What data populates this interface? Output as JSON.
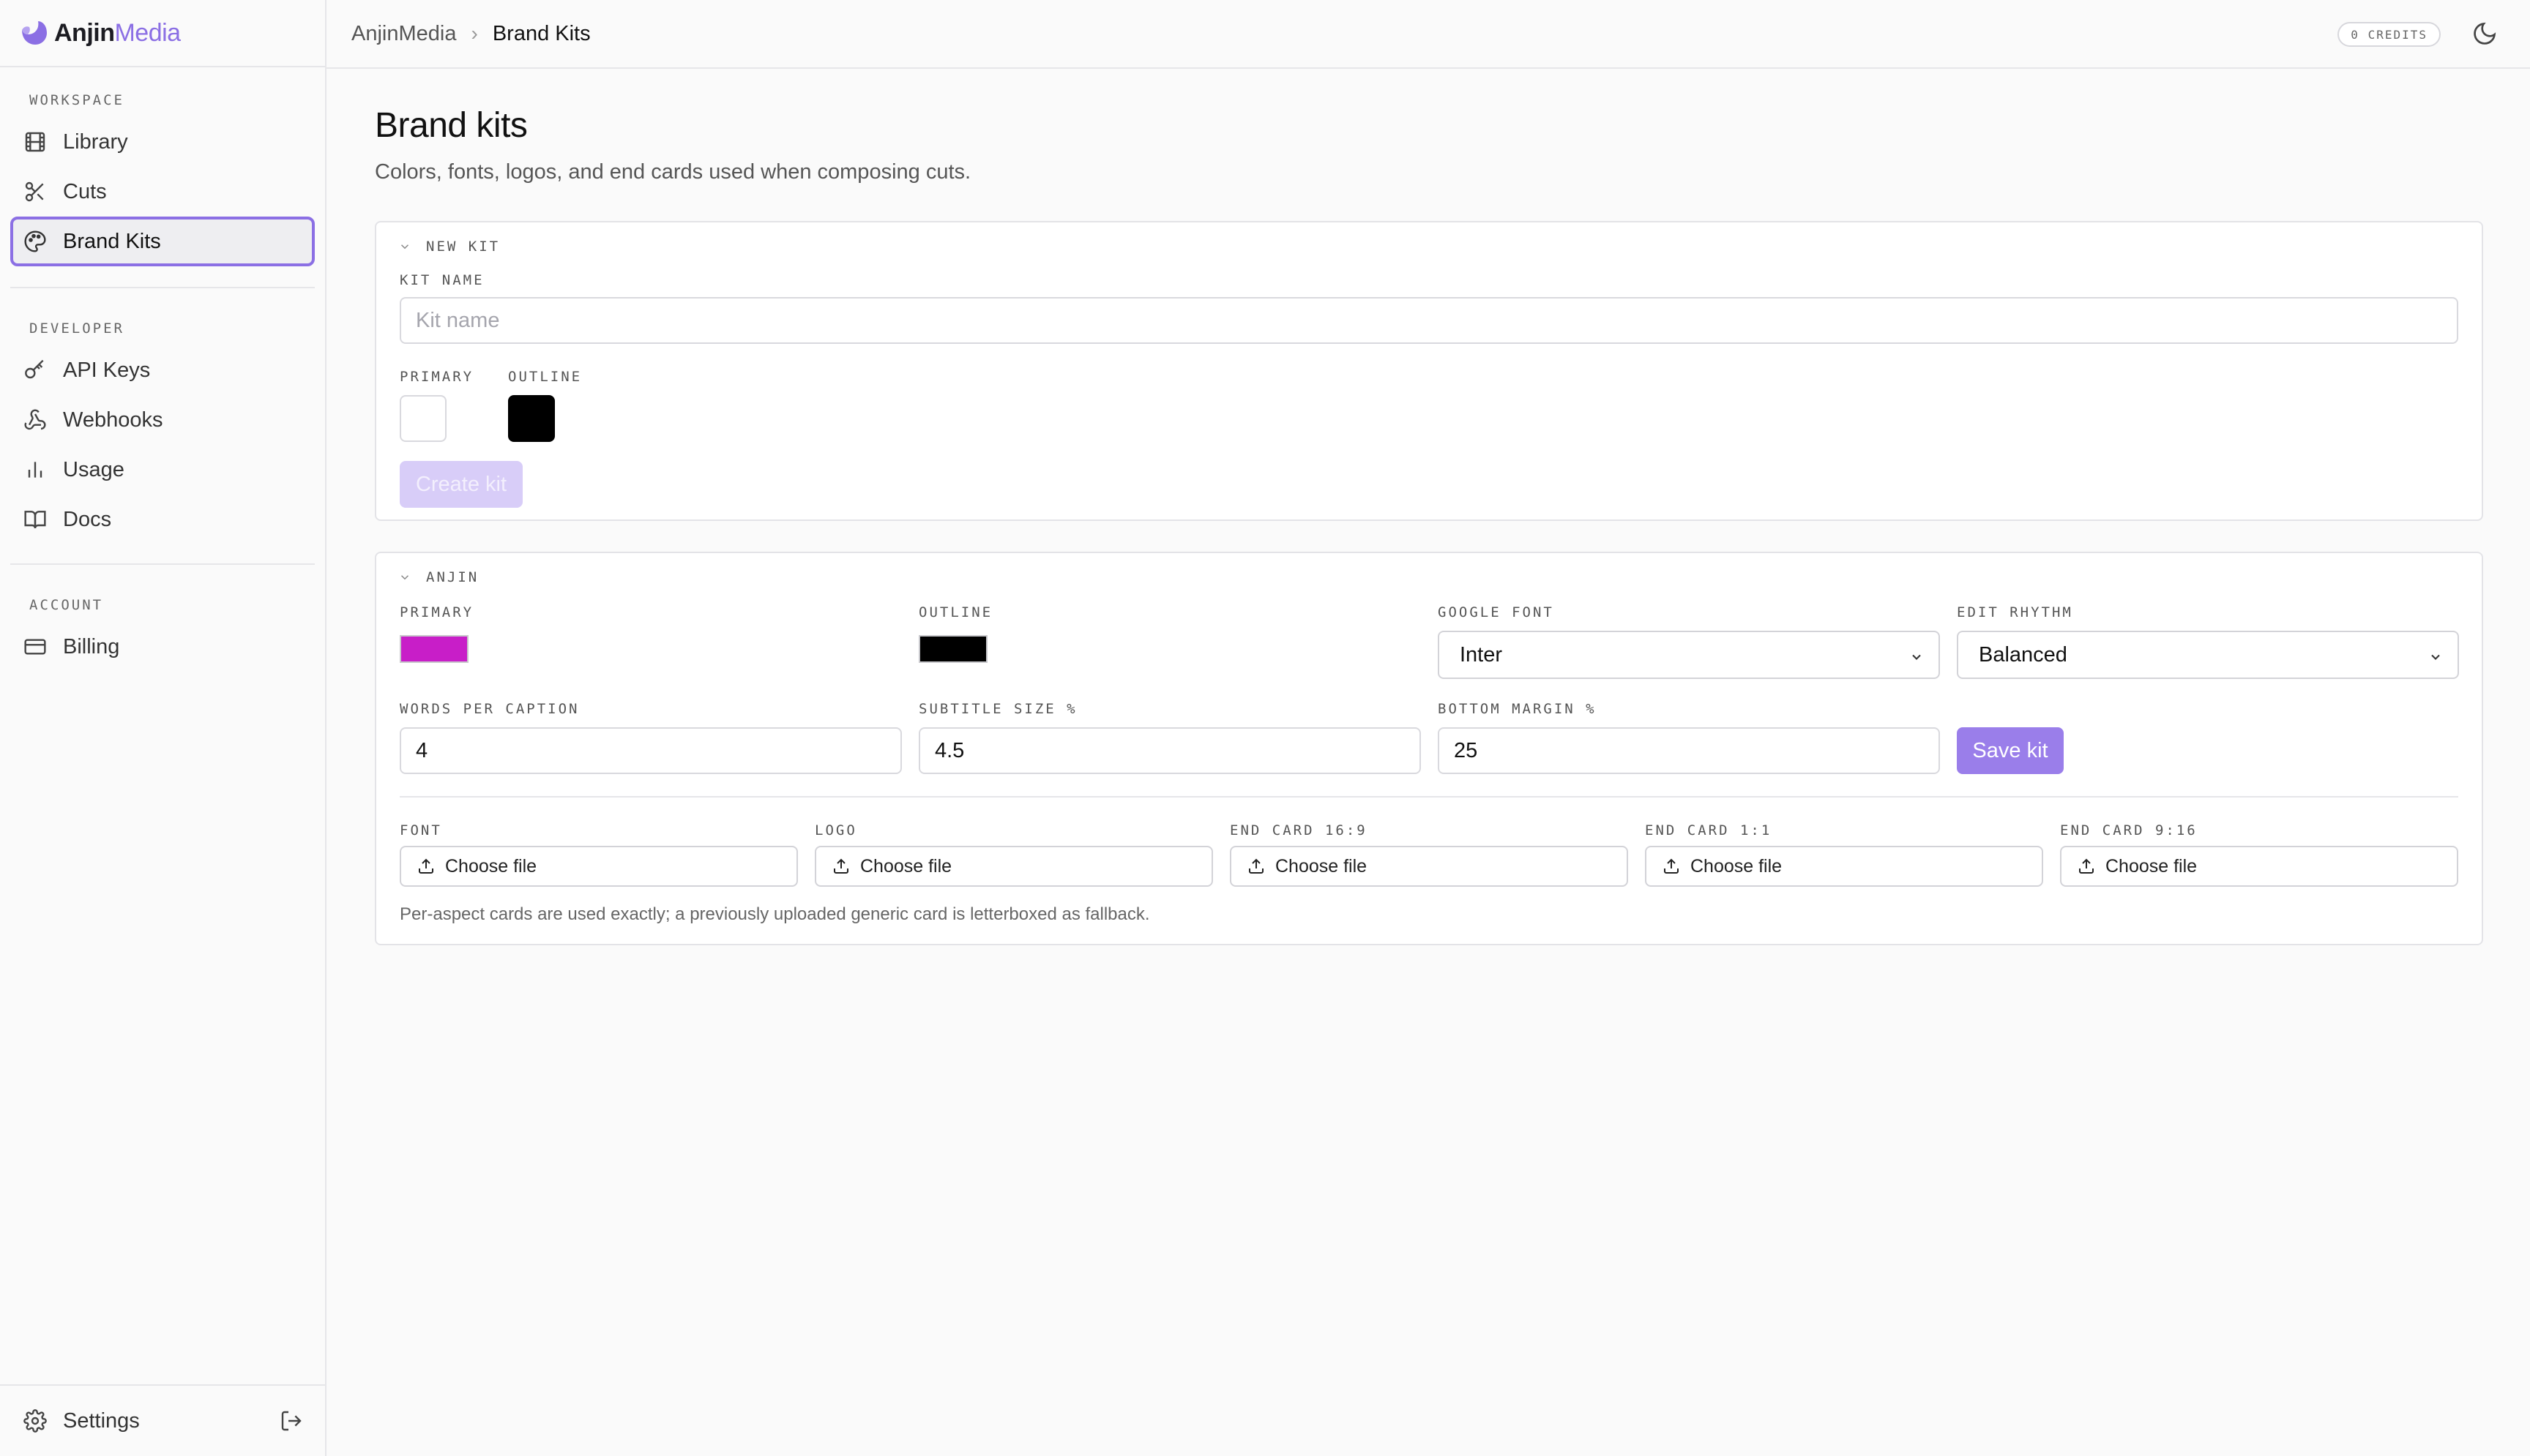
{
  "brand": {
    "name_main": "Anjin",
    "name_accent": "Media"
  },
  "sidebar": {
    "sections": {
      "workspace": "WORKSPACE",
      "developer": "DEVELOPER",
      "account": "ACCOUNT"
    },
    "items": {
      "library": "Library",
      "cuts": "Cuts",
      "brand_kits": "Brand Kits",
      "api_keys": "API Keys",
      "webhooks": "Webhooks",
      "usage": "Usage",
      "docs": "Docs",
      "billing": "Billing"
    },
    "active": "Brand Kits",
    "settings_label": "Settings"
  },
  "topbar": {
    "breadcrumb": [
      "AnjinMedia",
      "Brand Kits"
    ],
    "credits": "0 CREDITS"
  },
  "page": {
    "title": "Brand kits",
    "subtitle": "Colors, fonts, logos, and end cards used when composing cuts."
  },
  "new_kit": {
    "header": "NEW KIT",
    "kit_name_label": "KIT NAME",
    "kit_name_placeholder": "Kit name",
    "kit_name_value": "",
    "primary_label": "PRIMARY",
    "outline_label": "OUTLINE",
    "primary_color": "#ffffff",
    "outline_color": "#000000",
    "create_button": "Create kit"
  },
  "kit": {
    "header": "ANJIN",
    "primary_label": "PRIMARY",
    "outline_label": "OUTLINE",
    "google_font_label": "GOOGLE FONT",
    "edit_rhythm_label": "EDIT RHYTHM",
    "primary_color": "#c81ec8",
    "outline_color": "#000000",
    "google_font_value": "Inter",
    "edit_rhythm_value": "Balanced",
    "words_per_caption_label": "WORDS PER CAPTION",
    "subtitle_size_label": "SUBTITLE SIZE %",
    "bottom_margin_label": "BOTTOM MARGIN %",
    "words_per_caption": "4",
    "subtitle_size": "4.5",
    "bottom_margin": "25",
    "save_button": "Save kit",
    "uploads": {
      "font_label": "FONT",
      "logo_label": "LOGO",
      "end_card_16_9_label": "END CARD 16:9",
      "end_card_1_1_label": "END CARD 1:1",
      "end_card_9_16_label": "END CARD 9:16",
      "choose_file": "Choose file"
    },
    "note": "Per-aspect cards are used exactly; a previously uploaded generic card is letterboxed as fallback."
  },
  "colors": {
    "accent": "#8b6fe4",
    "button": "#9a7eea",
    "button_disabled": "#d8cdf8"
  }
}
